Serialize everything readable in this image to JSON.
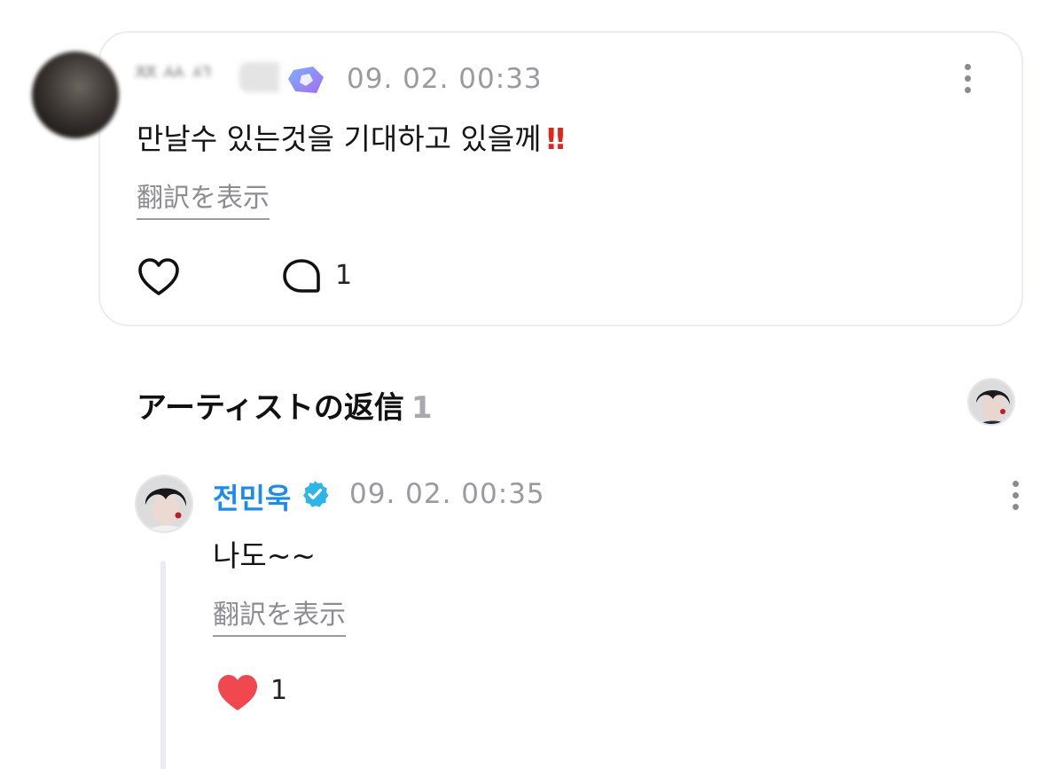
{
  "fan_comment": {
    "username": "ᄍᄊᄭ",
    "timestamp": "09. 02. 00:33",
    "text": "만날수 있는것을 기대하고 있을께",
    "text_emphasis": "‼",
    "translate_label": "翻訳を表示",
    "reply_count": "1"
  },
  "artist_replies": {
    "title": "アーティストの返信",
    "count": "1"
  },
  "artist_reply": {
    "username": "전민욱",
    "timestamp": "09. 02. 00:35",
    "text": "나도~~",
    "translate_label": "翻訳を表示",
    "like_count": "1"
  },
  "colors": {
    "artist_name": "#1a8bf0",
    "verified_badge": "#2bb5e8",
    "liked_heart": "#f0484e",
    "emphasis": "#e0251b"
  }
}
